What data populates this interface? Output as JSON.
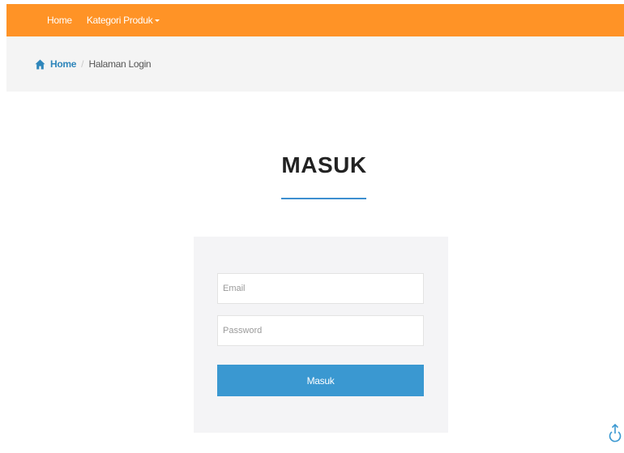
{
  "navbar": {
    "home_label": "Home",
    "kategori_label": "Kategori Produk",
    "background_color": "#ff9326"
  },
  "breadcrumb": {
    "home_label": "Home",
    "separator": "/",
    "current_label": "Halaman Login",
    "home_icon": "home-icon"
  },
  "login": {
    "title": "MASUK",
    "email_placeholder": "Email",
    "password_placeholder": "Password",
    "submit_label": "Masuk",
    "accent_color": "#3a98d1"
  },
  "scroll_top_icon": "scroll-to-top-icon"
}
